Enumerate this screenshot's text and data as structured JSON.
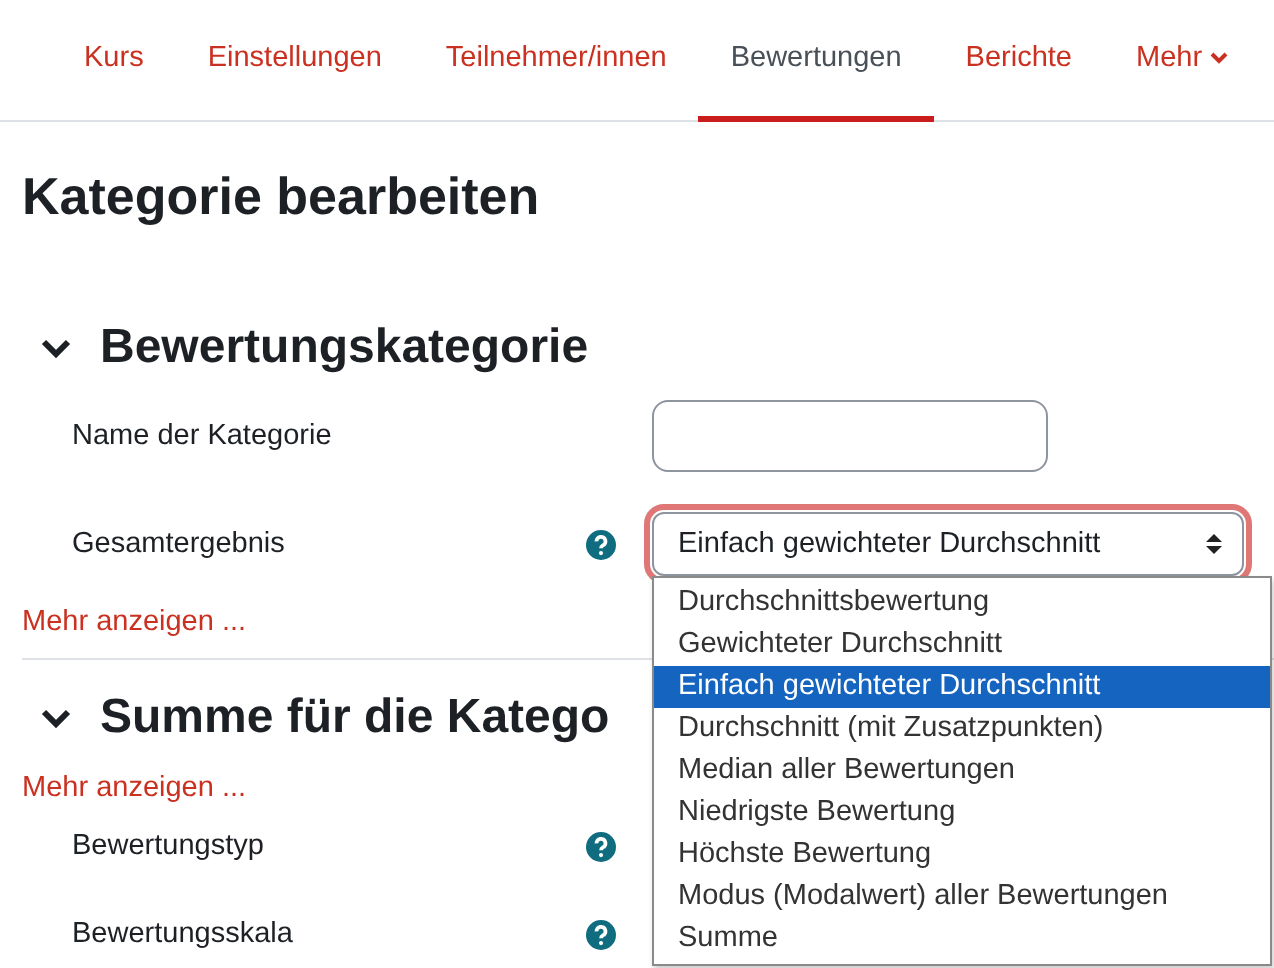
{
  "tabs": [
    {
      "label": "Kurs",
      "selected": false,
      "kind": "link"
    },
    {
      "label": "Einstellungen",
      "selected": false,
      "kind": "link"
    },
    {
      "label": "Teilnehmer/innen",
      "selected": false,
      "kind": "link"
    },
    {
      "label": "Bewertungen",
      "selected": true,
      "kind": "link"
    },
    {
      "label": "Berichte",
      "selected": false,
      "kind": "link"
    },
    {
      "label": "Mehr",
      "selected": false,
      "kind": "menu"
    }
  ],
  "page_title": "Kategorie bearbeiten",
  "sections": [
    {
      "title": "Bewertungskategorie",
      "expanded": true,
      "fields": [
        {
          "label": "Name der Kategorie",
          "help": false,
          "kind": "text"
        },
        {
          "label": "Gesamtergebnis",
          "help": true,
          "kind": "select",
          "value": "Einfach gewichteter Durchschnitt",
          "focused": true
        }
      ],
      "more_link": "Mehr anzeigen ..."
    },
    {
      "title": "Summe für die Katego",
      "expanded": true,
      "more_link": "Mehr anzeigen ...",
      "fields": [
        {
          "label": "Bewertungstyp",
          "help": true
        },
        {
          "label": "Bewertungsskala",
          "help": true
        }
      ]
    }
  ],
  "dropdown": {
    "options": [
      {
        "label": "Durchschnittsbewertung",
        "selected": false
      },
      {
        "label": "Gewichteter Durchschnitt",
        "selected": false
      },
      {
        "label": "Einfach gewichteter Durchschnitt",
        "selected": true
      },
      {
        "label": "Durchschnitt (mit Zusatzpunkten)",
        "selected": false
      },
      {
        "label": "Median aller Bewertungen",
        "selected": false
      },
      {
        "label": "Niedrigste Bewertung",
        "selected": false
      },
      {
        "label": "Höchste Bewertung",
        "selected": false
      },
      {
        "label": "Modus (Modalwert) aller Bewertungen",
        "selected": false
      },
      {
        "label": "Summe",
        "selected": false
      }
    ]
  }
}
